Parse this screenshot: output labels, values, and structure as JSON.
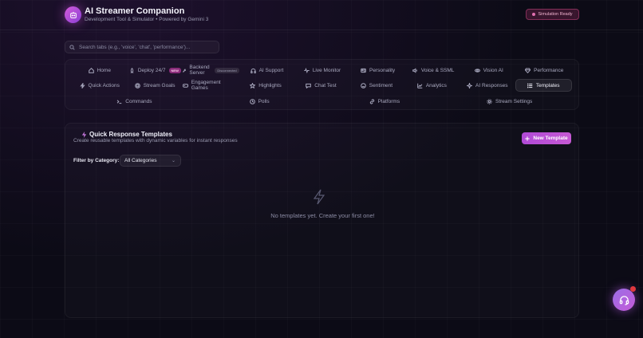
{
  "header": {
    "title": "AI Streamer Companion",
    "subtitle": "Development Tool & Simulator • Powered by Gemini 3",
    "status_badge": "Simulation Ready"
  },
  "search": {
    "placeholder": "Search tabs (e.g., 'voice', 'chat', 'performance')..."
  },
  "tabs": {
    "row1": [
      {
        "label": "Home",
        "icon": "home-icon"
      },
      {
        "label": "Deploy 24/7",
        "icon": "rocket-icon",
        "badge": "NEW"
      },
      {
        "label": "Backend Server",
        "icon": "wrench-icon",
        "badge": "Disconnected"
      },
      {
        "label": "AI Support",
        "icon": "headphones-icon"
      },
      {
        "label": "Live Monitor",
        "icon": "activity-icon"
      },
      {
        "label": "Personality",
        "icon": "user-card-icon"
      },
      {
        "label": "Voice & SSML",
        "icon": "speaker-icon"
      },
      {
        "label": "Vision AI",
        "icon": "eye-icon"
      },
      {
        "label": "Performance",
        "icon": "gem-icon"
      }
    ],
    "row2": [
      {
        "label": "Quick Actions",
        "icon": "bolt-icon"
      },
      {
        "label": "Stream Goals",
        "icon": "target-icon"
      },
      {
        "label": "Engagement Games",
        "icon": "gamepad-icon"
      },
      {
        "label": "Highlights",
        "icon": "star-icon"
      },
      {
        "label": "Chat Test",
        "icon": "chat-icon"
      },
      {
        "label": "Sentiment",
        "icon": "smile-icon"
      },
      {
        "label": "Analytics",
        "icon": "chart-icon"
      },
      {
        "label": "AI Responses",
        "icon": "sparkle-icon"
      },
      {
        "label": "Templates",
        "icon": "list-icon",
        "active": true
      }
    ],
    "row3": [
      {
        "label": "Commands",
        "icon": "terminal-icon"
      },
      {
        "label": "Polls",
        "icon": "clock-icon"
      },
      {
        "label": "Platforms",
        "icon": "link-icon"
      },
      {
        "label": "Stream Settings",
        "icon": "gear-icon"
      }
    ]
  },
  "main": {
    "title": "Quick Response Templates",
    "subtitle": "Create reusable templates with dynamic variables for instant responses",
    "new_button": "New Template",
    "filter_label": "Filter by Category:",
    "filter_value": "All Categories",
    "empty_text": "No templates yet. Create your first one!"
  },
  "colors": {
    "accent": "#c659d4",
    "background": "#0c0b16"
  }
}
